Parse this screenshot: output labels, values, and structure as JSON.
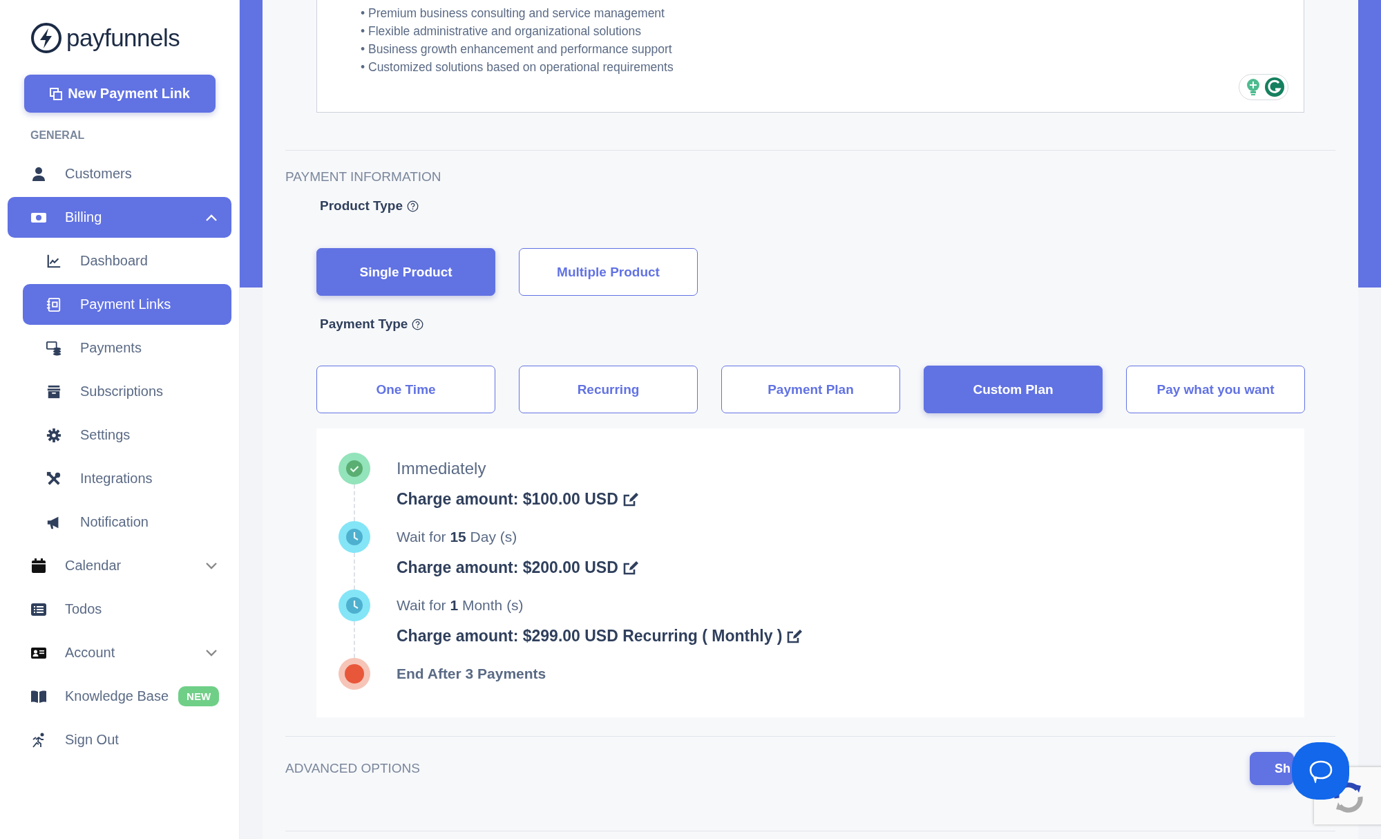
{
  "sidebar": {
    "logo": "payfunnels",
    "new_button": "New Payment Link",
    "section": "GENERAL",
    "items": [
      {
        "label": "Customers",
        "selected": false
      },
      {
        "label": "Billing",
        "selected": true,
        "expanded": true,
        "children": [
          {
            "label": "Dashboard",
            "selected": false
          },
          {
            "label": "Payment Links",
            "selected": true
          },
          {
            "label": "Payments",
            "selected": false
          },
          {
            "label": "Subscriptions",
            "selected": false
          },
          {
            "label": "Settings",
            "selected": false
          },
          {
            "label": "Integrations",
            "selected": false
          },
          {
            "label": "Notification",
            "selected": false
          }
        ]
      },
      {
        "label": "Calendar",
        "selected": false,
        "expanded": false
      },
      {
        "label": "Todos",
        "selected": false
      },
      {
        "label": "Account",
        "selected": false,
        "expanded": false
      },
      {
        "label": "Knowledge Base",
        "selected": false,
        "badge": "NEW"
      },
      {
        "label": "Sign Out",
        "selected": false
      }
    ]
  },
  "description": {
    "bullets": [
      "• Premium business consulting and service management",
      "• Flexible administrative and organizational solutions",
      "• Business growth enhancement and performance support",
      "• Customized solutions based on operational requirements"
    ]
  },
  "payment_information": {
    "heading": "PAYMENT INFORMATION",
    "product_type": {
      "label": "Product Type",
      "options": [
        {
          "label": "Single Product",
          "selected": true
        },
        {
          "label": "Multiple Product",
          "selected": false
        }
      ]
    },
    "payment_type": {
      "label": "Payment Type",
      "options": [
        {
          "label": "One Time",
          "selected": false
        },
        {
          "label": "Recurring",
          "selected": false
        },
        {
          "label": "Payment Plan",
          "selected": false
        },
        {
          "label": "Custom Plan",
          "selected": true
        },
        {
          "label": "Pay what you want",
          "selected": false
        }
      ]
    },
    "schedule": [
      {
        "kind": "immediate",
        "title": "Immediately",
        "charge": "Charge amount: $100.00 USD"
      },
      {
        "kind": "wait",
        "title": "Wait for **15**  Day (s)",
        "charge": "Charge amount: $200.00 USD"
      },
      {
        "kind": "wait",
        "title": "Wait for **1**  Month (s)",
        "charge": "Charge amount: $299.00 USD Recurring ( Monthly )"
      },
      {
        "kind": "end",
        "title": "End After 3 Payments"
      }
    ]
  },
  "advanced_options": {
    "heading": "ADVANCED OPTIONS",
    "button": "Sh"
  }
}
